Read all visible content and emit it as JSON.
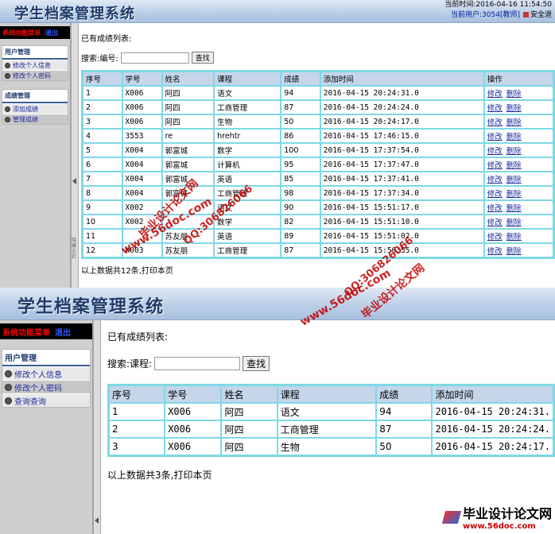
{
  "shot1": {
    "title": "学生档案管理系统",
    "time": "当前时间:2016-04-16 11:54:50",
    "user": "当前用户:3054[教师]",
    "logout": "安全退",
    "menu_head": "系统功能菜单",
    "menu_exit": "退出",
    "groups": [
      {
        "title": "用户管理",
        "items": [
          "修改个人信息",
          "修改个人密码"
        ]
      },
      {
        "title": "成绩管理",
        "items": [
          "添加成绩",
          "管理成绩"
        ]
      }
    ],
    "heading": "已有成绩列表:",
    "search_label": "搜索:编号:",
    "search_value": "",
    "search_button": "查找",
    "columns": [
      "序号",
      "学号",
      "姓名",
      "课程",
      "成绩",
      "添加时间",
      "操作"
    ],
    "rows": [
      [
        "1",
        "X006",
        "阿四",
        "语文",
        "94",
        "2016-04-15 20:24:31.0"
      ],
      [
        "2",
        "X006",
        "阿四",
        "工商管理",
        "87",
        "2016-04-15 20:24:24.0"
      ],
      [
        "3",
        "X006",
        "阿四",
        "生物",
        "50",
        "2016-04-15 20:24:17.0"
      ],
      [
        "4",
        "3553",
        "re",
        "hrehtr",
        "86",
        "2016-04-15 17:46:15.0"
      ],
      [
        "5",
        "X004",
        "郭富城",
        "数学",
        "100",
        "2016-04-15 17:37:54.0"
      ],
      [
        "6",
        "X004",
        "郭富城",
        "计算机",
        "95",
        "2016-04-15 17:37:47.0"
      ],
      [
        "7",
        "X004",
        "郭富城",
        "英语",
        "85",
        "2016-04-15 17:37:41.0"
      ],
      [
        "8",
        "X004",
        "郭富城",
        "工商管理",
        "98",
        "2016-04-15 17:37:34.0"
      ],
      [
        "9",
        "X002",
        "",
        "语文",
        "90",
        "2016-04-15 15:51:17.0"
      ],
      [
        "10",
        "X002",
        "",
        "数学",
        "82",
        "2016-04-15 15:51:10.0"
      ],
      [
        "11",
        "",
        "苏友朋",
        "英语",
        "89",
        "2016-04-15 15:51:02.0"
      ],
      [
        "12",
        "X003",
        "苏友朋",
        "工商管理",
        "87",
        "2016-04-15 15:50:55.0"
      ]
    ],
    "action_edit": "修改",
    "action_delete": "删除",
    "footer": "以上数据共12条,打印本页",
    "splitter_text": "隐藏左栏"
  },
  "shot2": {
    "title": "学生档案管理系统",
    "menu_head": "系统功能菜单",
    "menu_exit": "退出",
    "group_title": "用户管理",
    "items": [
      "修改个人信息",
      "修改个人密码",
      "查询查询"
    ],
    "heading": "已有成绩列表:",
    "search_label": "搜索:课程:",
    "search_value": "",
    "search_button": "查找",
    "columns": [
      "序号",
      "学号",
      "姓名",
      "课程",
      "成绩",
      "添加时间"
    ],
    "rows": [
      [
        "1",
        "X006",
        "阿四",
        "语文",
        "94",
        "2016-04-15 20:24:31."
      ],
      [
        "2",
        "X006",
        "阿四",
        "工商管理",
        "87",
        "2016-04-15 20:24:24."
      ],
      [
        "3",
        "X006",
        "阿四",
        "生物",
        "50",
        "2016-04-15 20:24:17."
      ]
    ],
    "footer": "以上数据共3条,打印本页"
  },
  "watermark": {
    "site": "www.56doc.com",
    "qq": "QQ:306826066",
    "name": "毕业设计论文网",
    "badge_site": "www.56doc.com"
  }
}
